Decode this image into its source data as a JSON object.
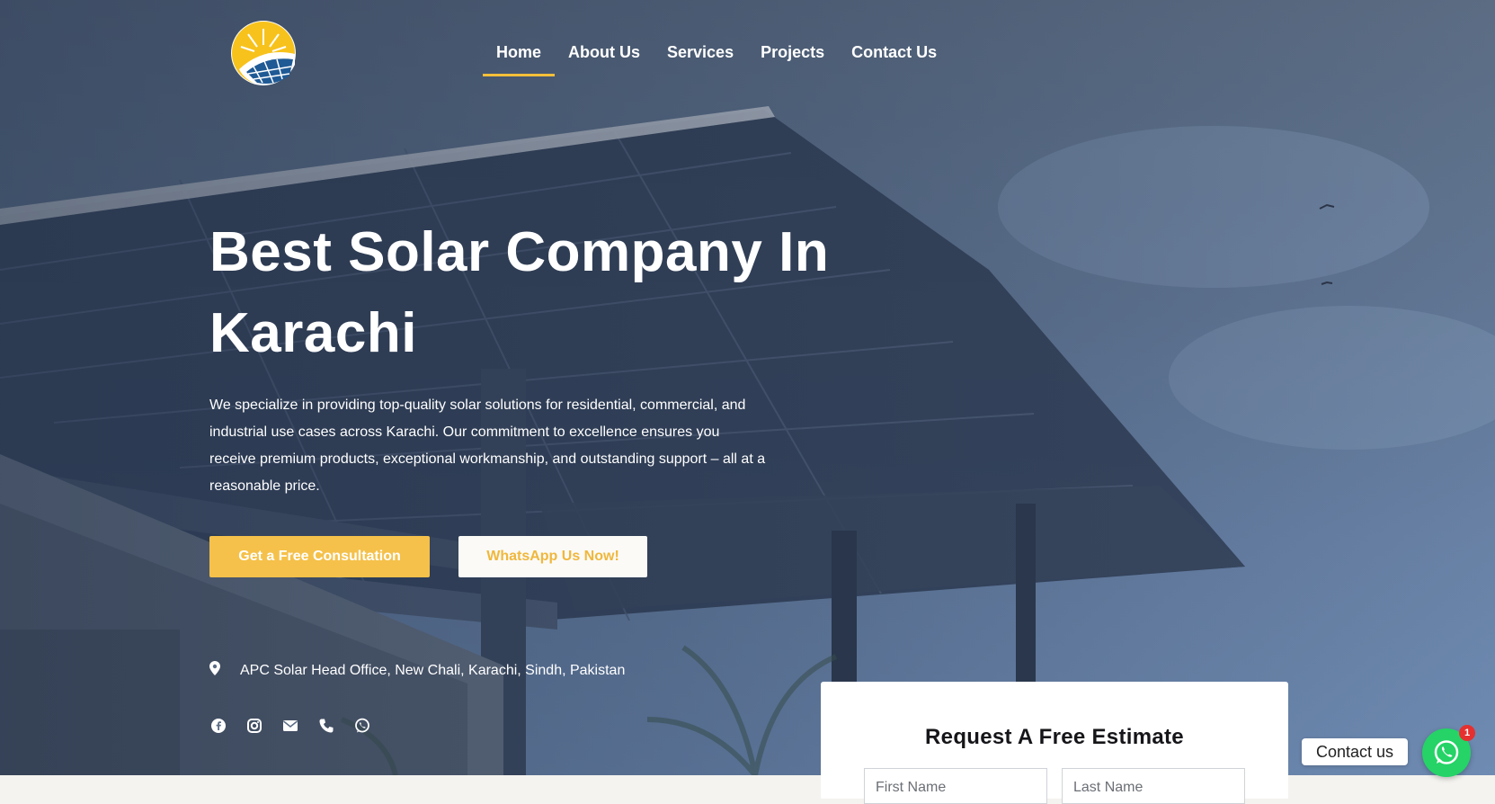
{
  "nav": {
    "items": [
      {
        "label": "Home",
        "active": true
      },
      {
        "label": "About Us",
        "active": false
      },
      {
        "label": "Services",
        "active": false
      },
      {
        "label": "Projects",
        "active": false
      },
      {
        "label": "Contact Us",
        "active": false
      }
    ]
  },
  "hero": {
    "title": "Best Solar Company In Karachi",
    "description": "We specialize in providing top-quality solar solutions for residential, commercial, and industrial use cases across Karachi. Our commitment to excellence ensures you receive premium products, exceptional workmanship, and outstanding support – all at a reasonable price.",
    "primary_button": "Get a Free Consultation",
    "secondary_button": "WhatsApp Us Now!",
    "address": "APC Solar Head Office, New Chali, Karachi, Sindh, Pakistan",
    "social_icons": [
      "facebook-icon",
      "instagram-icon",
      "email-icon",
      "phone-icon",
      "whatsapp-icon"
    ]
  },
  "estimate_form": {
    "title": "Request A Free Estimate",
    "first_name_placeholder": "First Name",
    "last_name_placeholder": "Last Name"
  },
  "chat_widget": {
    "label": "Contact us",
    "badge_count": "1"
  },
  "colors": {
    "accent": "#f5c14a",
    "whatsapp": "#25d366",
    "badge": "#e53030"
  }
}
